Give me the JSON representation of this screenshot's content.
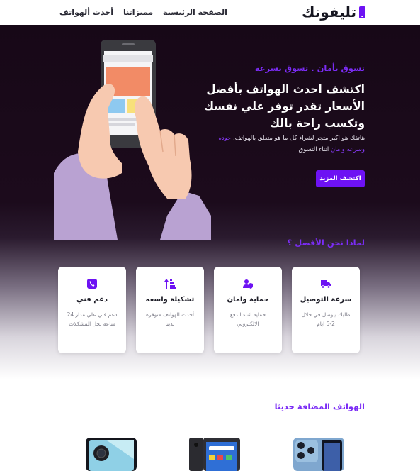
{
  "header": {
    "logo_text": "تليفونك",
    "nav": [
      "الصفحة الرئيسية",
      "مميزاتنا",
      "أحدث ألهواتف"
    ]
  },
  "hero": {
    "tagline": "تسوق بأمان . تسوق بسرعة",
    "title": "اكتشف احدث الهواتف بأفضل الأسعار تقدر توفر علي نفسك وتكسب راحة بالك",
    "desc_main": "هاتفك هو اكبر متجر لشراء كل ما هو متعلق بالهواتف.",
    "desc_highlight": "جوده وسرعه وامان",
    "desc_end": "اثناء التسوق",
    "cta_label": "اكتشف المزيد"
  },
  "why": {
    "title": "لماذا نحن الأفضل ؟",
    "cards": [
      {
        "icon": "truck-icon",
        "title": "سرعة التوصيل",
        "text": "طلبك بيوصل في خلال 2-5 ايام"
      },
      {
        "icon": "user-shield-icon",
        "title": "حماية وامان",
        "text": "حماية اثناء الدفع الالكتروني"
      },
      {
        "icon": "sort-list-icon",
        "title": "تشكيلة واسعه",
        "text": "أحدث الهواتف متوفره لدينا"
      },
      {
        "icon": "phone-support-icon",
        "title": "دعم فني",
        "text": "دعم فني علي مدار 24 ساعه لحل المشكلات"
      }
    ]
  },
  "new_phones": {
    "title": "الهواتف المضافة حديثا"
  },
  "colors": {
    "accent": "#6d12f3",
    "hero_bg": "#170817"
  }
}
